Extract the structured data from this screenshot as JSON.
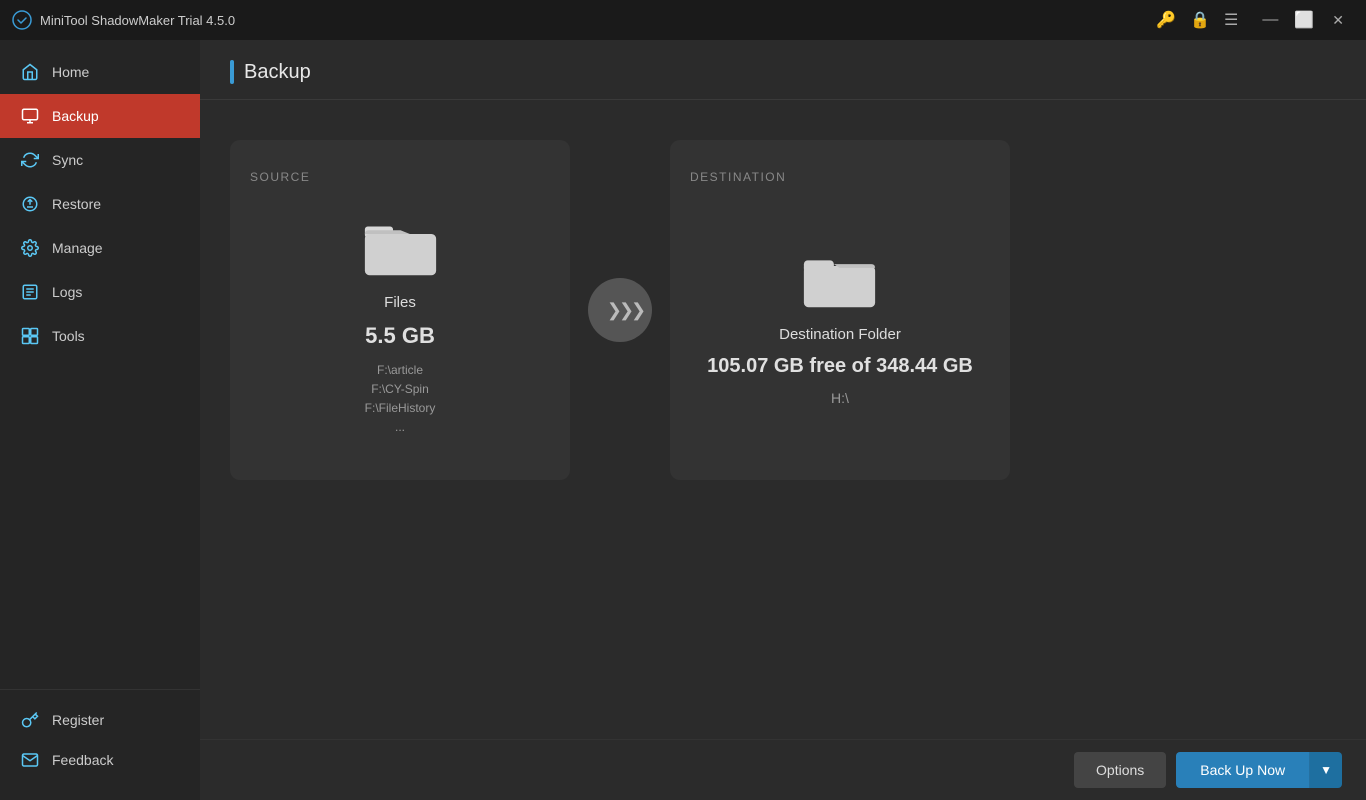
{
  "titleBar": {
    "appName": "MiniTool ShadowMaker Trial 4.5.0",
    "icons": {
      "key": "🔑",
      "lock": "🔒",
      "menu": "☰",
      "minimize": "—",
      "restore": "⬜",
      "close": "✕"
    }
  },
  "sidebar": {
    "items": [
      {
        "id": "home",
        "label": "Home",
        "icon": "🏠"
      },
      {
        "id": "backup",
        "label": "Backup",
        "icon": "🗂"
      },
      {
        "id": "sync",
        "label": "Sync",
        "icon": "🔄"
      },
      {
        "id": "restore",
        "label": "Restore",
        "icon": "↺"
      },
      {
        "id": "manage",
        "label": "Manage",
        "icon": "⚙"
      },
      {
        "id": "logs",
        "label": "Logs",
        "icon": "📋"
      },
      {
        "id": "tools",
        "label": "Tools",
        "icon": "🔧"
      }
    ],
    "bottomItems": [
      {
        "id": "register",
        "label": "Register",
        "icon": "🔑"
      },
      {
        "id": "feedback",
        "label": "Feedback",
        "icon": "✉"
      }
    ]
  },
  "page": {
    "title": "Backup"
  },
  "source": {
    "label": "SOURCE",
    "iconAlt": "open folder",
    "fileType": "Files",
    "size": "5.5 GB",
    "paths": [
      "F:\\article",
      "F:\\CY-Spin",
      "F:\\FileHistory",
      "..."
    ]
  },
  "arrow": {
    "symbol": "»»»"
  },
  "destination": {
    "label": "DESTINATION",
    "iconAlt": "folder",
    "folderLabel": "Destination Folder",
    "freeSpace": "105.07 GB free of 348.44 GB",
    "drive": "H:\\"
  },
  "footer": {
    "optionsLabel": "Options",
    "backupNowLabel": "Back Up Now",
    "backupArrow": "▼"
  }
}
